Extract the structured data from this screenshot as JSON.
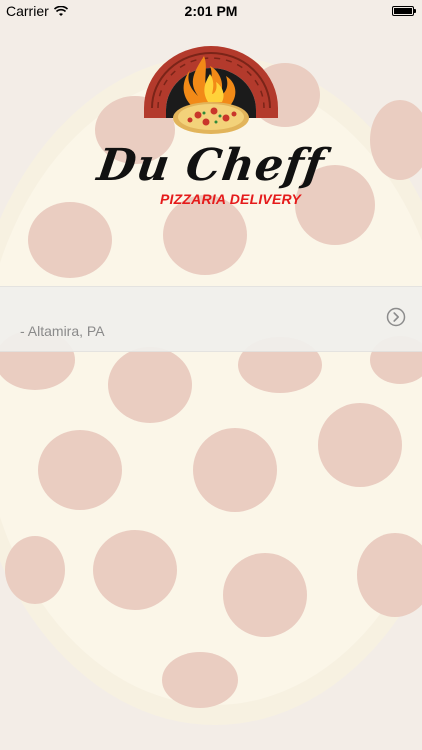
{
  "status_bar": {
    "carrier": "Carrier",
    "time": "2:01 PM"
  },
  "brand": {
    "name": "Du Cheff",
    "tagline": "PIZZARIA DELIVERY"
  },
  "location": {
    "label": "- Altamira, PA"
  },
  "colors": {
    "accent_red": "#e51b1b",
    "row_background": "#f0efec"
  },
  "icons": [
    "wifi-icon",
    "battery-icon",
    "pizza-oven-logo-icon",
    "chevron-right-circle-icon"
  ]
}
